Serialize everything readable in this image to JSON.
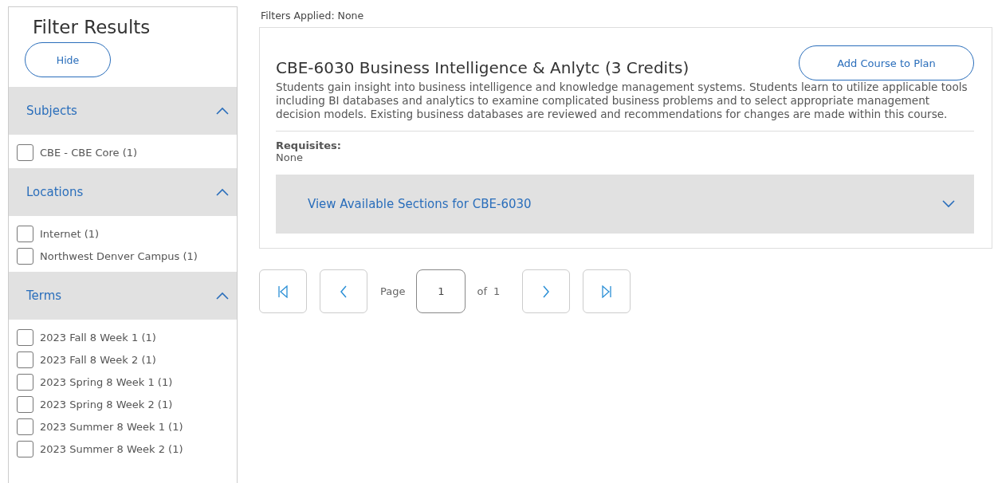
{
  "sidebar": {
    "title": "Filter Results",
    "hide_button": "Hide",
    "sections": [
      {
        "title": "Subjects",
        "expanded": true,
        "items": [
          {
            "label": "CBE - CBE Core (1)",
            "checked": false
          }
        ]
      },
      {
        "title": "Locations",
        "expanded": true,
        "items": [
          {
            "label": "Internet (1)",
            "checked": false
          },
          {
            "label": "Northwest Denver Campus (1)",
            "checked": false
          }
        ]
      },
      {
        "title": "Terms",
        "expanded": true,
        "items": [
          {
            "label": "2023 Fall 8 Week 1 (1)",
            "checked": false
          },
          {
            "label": "2023 Fall 8 Week 2 (1)",
            "checked": false
          },
          {
            "label": "2023 Spring 8 Week 1 (1)",
            "checked": false
          },
          {
            "label": "2023 Spring 8 Week 2 (1)",
            "checked": false
          },
          {
            "label": "2023 Summer 8 Week 1 (1)",
            "checked": false
          },
          {
            "label": "2023 Summer 8 Week 2 (1)",
            "checked": false
          }
        ]
      }
    ]
  },
  "filters_applied": "Filters Applied: None",
  "course": {
    "title": "CBE-6030 Business Intelligence & Anlytc (3 Credits)",
    "add_button": "Add Course to Plan",
    "description": "Students gain insight into business intelligence and knowledge management systems. Students learn to utilize applicable tools including BI databases and analytics to examine complicated business problems and to select appropriate management decision models. Existing business databases are reviewed and recommendations for changes are made within this course.",
    "requisites_label": "Requisites:",
    "requisites_value": "None",
    "sections_toggle": {
      "label": "View Available Sections for CBE-6030",
      "expanded": false
    }
  },
  "pagination": {
    "page_label": "Page",
    "page": "1",
    "of_label": "of",
    "total": "1"
  }
}
